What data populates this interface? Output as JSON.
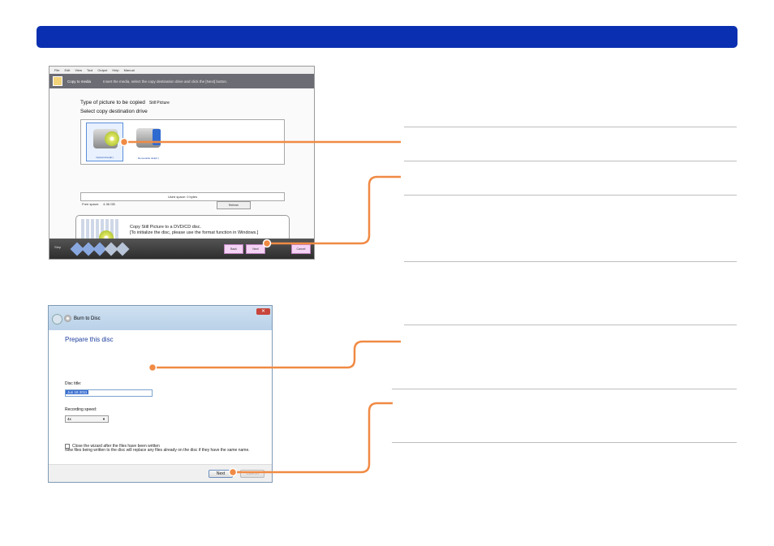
{
  "colors": {
    "header_bar": "#0a2fb0",
    "callout_line": "#f08a44"
  },
  "screenshot1": {
    "menu": [
      "File",
      "Edit",
      "View",
      "Tool",
      "Output",
      "Help",
      "Manual"
    ],
    "header": {
      "title": "Copy to media",
      "instruction": "Insert the media, select the copy destination drive and click the [Next] button."
    },
    "type_label": "Type of picture to be copied",
    "type_value": "Still Picture",
    "select_label": "Select copy destination drive",
    "drives": [
      {
        "label": "Optical drive(E:)",
        "icon": "optical-drive-icon",
        "selected": true
      },
      {
        "label": "Removable disk(F:)",
        "icon": "removable-disk-icon",
        "selected": false
      }
    ],
    "used_space": "Used space: 0 bytes",
    "free_space_label": "Free space:",
    "free_space_value": "4.38 GB",
    "refresh_label": "Refresh",
    "info_text": "Copy Still Picture to a DVD/CD disc.\n[To initialize the disc, please use the format function in Windows.]",
    "steps_label": "Step",
    "buttons": {
      "back": "Back",
      "next": "Next",
      "cancel": "Cancel"
    }
  },
  "screenshot2": {
    "title": "Burn to Disc",
    "heading": "Prepare this disc",
    "disc_title_label": "Disc title:",
    "disc_title_value": "Jun 18 2011",
    "recording_speed_label": "Recording speed:",
    "recording_speed_value": "4x",
    "note": "New files being written to the disc will replace any files already on the disc if they have the same name.",
    "close_wizard_label": "Close the wizard after the files have been written",
    "buttons": {
      "next": "Next",
      "cancel": "Cancel"
    }
  }
}
